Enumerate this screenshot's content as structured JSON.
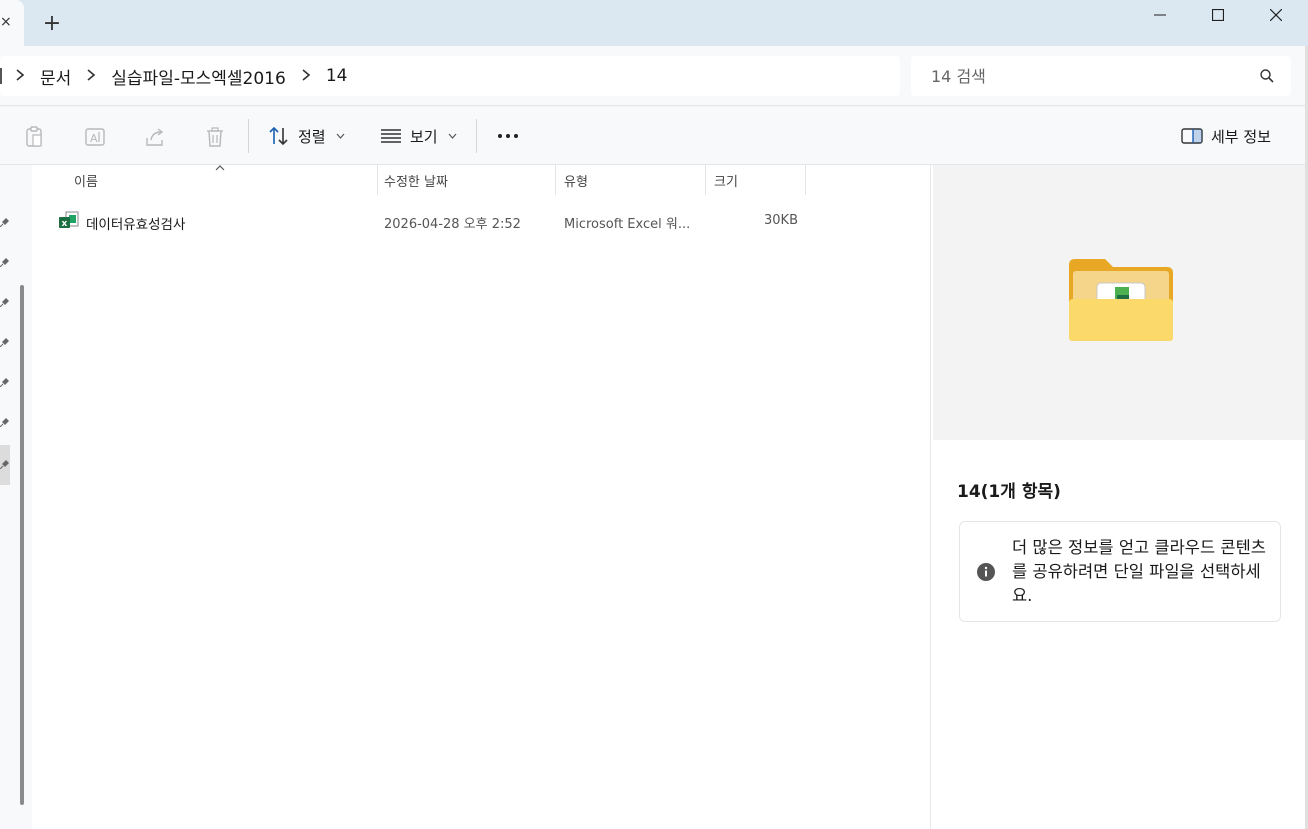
{
  "window": {
    "tab_close_glyph": "×",
    "new_tab_glyph": "+"
  },
  "address": {
    "crumbs": [
      "문서",
      "실습파일-모스엑셀2016",
      "14"
    ]
  },
  "search": {
    "placeholder": "14 검색"
  },
  "toolbar": {
    "sort_label": "정렬",
    "view_label": "보기",
    "details_label": "세부 정보"
  },
  "filelist": {
    "columns": [
      "이름",
      "수정한 날짜",
      "유형",
      "크기"
    ],
    "rows": [
      {
        "name": "데이터유효성검사",
        "modified": "2026-04-28 오후 2:52",
        "type": "Microsoft Excel 워...",
        "size": "30KB"
      }
    ]
  },
  "details": {
    "title": "14(1개 항목)",
    "info": "더 많은 정보를 얻고 클라우드 콘텐츠를 공유하려면 단일 파일을 선택하세요."
  },
  "colors": {
    "titlebar": "#dbe7f1",
    "excel_green": "#1d6f42",
    "folder_yellow": "#f2c14e"
  },
  "icons": [
    "new-tab-icon",
    "minimize-icon",
    "maximize-icon",
    "close-icon",
    "chevron-right-icon",
    "search-icon",
    "paste-icon",
    "rename-icon",
    "share-icon",
    "delete-icon",
    "sort-icon",
    "view-icon",
    "more-icon",
    "details-pane-icon",
    "excel-file-icon",
    "folder-icon",
    "info-icon",
    "pin-icon"
  ]
}
